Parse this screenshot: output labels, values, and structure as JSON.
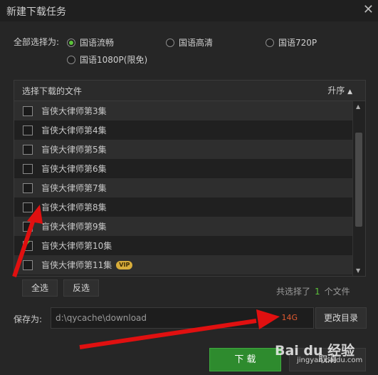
{
  "dialog": {
    "title": "新建下载任务",
    "close_symbol": "✕"
  },
  "quality": {
    "label": "全部选择为:",
    "options": [
      {
        "label": "国语流畅",
        "selected": true
      },
      {
        "label": "国语高清",
        "selected": false
      },
      {
        "label": "国语720P",
        "selected": false
      },
      {
        "label": "国语1080P(限免)",
        "selected": false
      }
    ]
  },
  "file_list": {
    "header": "选择下载的文件",
    "sort_label": "升序",
    "sort_icon": "▲",
    "items": [
      {
        "label": "盲侠大律师第3集",
        "checked": false
      },
      {
        "label": "盲侠大律师第4集",
        "checked": false
      },
      {
        "label": "盲侠大律师第5集",
        "checked": false
      },
      {
        "label": "盲侠大律师第6集",
        "checked": false
      },
      {
        "label": "盲侠大律师第7集",
        "checked": false
      },
      {
        "label": "盲侠大律师第8集",
        "checked": false
      },
      {
        "label": "盲侠大律师第9集",
        "checked": false
      },
      {
        "label": "盲侠大律师第10集",
        "checked": true
      },
      {
        "label": "盲侠大律师第11集",
        "checked": false,
        "badge": "VIP"
      }
    ]
  },
  "actions": {
    "select_all": "全选",
    "invert": "反选"
  },
  "selection": {
    "prefix": "共选择了",
    "count": "1",
    "suffix": "个文件"
  },
  "save": {
    "label": "保存为:",
    "path": "d:\\qycache\\download",
    "free_space": "14G",
    "change_dir": "更改目录"
  },
  "buttons": {
    "download": "下 载",
    "cancel": "取消"
  },
  "watermark": {
    "text": "Bai du 经验",
    "url": "jingyan.baidu.com"
  }
}
